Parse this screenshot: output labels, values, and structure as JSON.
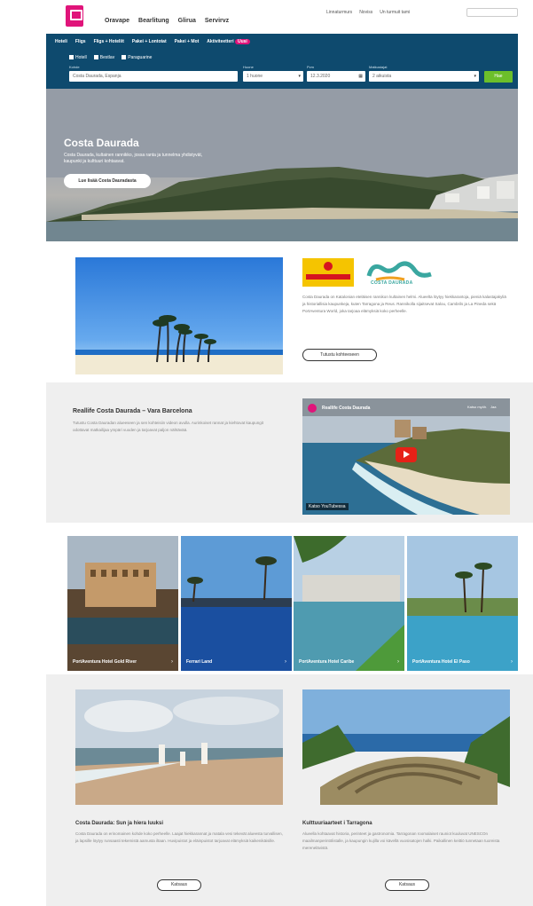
{
  "header": {
    "nav": [
      "Oravape",
      "Bearlitung",
      "Glirua",
      "Servirvz"
    ],
    "links": [
      "Linnaturmurs",
      "Noviss",
      "Un turmuit tami"
    ],
    "search_placeholder": ""
  },
  "booking": {
    "tabs": [
      "Hoteli",
      "Fligs",
      "Fligs + Hoteliit",
      "Pakei + Lontotat",
      "Pakei + Mot",
      "Aktiviteetteri"
    ],
    "new_badge": "Uusi",
    "options": [
      "Hotell",
      "Bestlav",
      "Paraguarine"
    ],
    "fields": {
      "destination": {
        "label": "Kohde",
        "value": "Costa Daurada, Espanja"
      },
      "rooms": {
        "label": "Huone",
        "value": "1 huone"
      },
      "date": {
        "label": "Pvm",
        "value": "12.3.2020"
      },
      "guests": {
        "label": "Matkustajat",
        "value": "2 aikuista"
      }
    },
    "search_button": "Hae"
  },
  "hero": {
    "title": "Costa Daurada",
    "subtitle": "Costa Daurada, kultainen rannikko, jossa ranta ja tunnelma yhdistyvät, kaupunki ja kulttuuri kohtaavat.",
    "button": "Lue lisää Costa Dauradasta",
    "colors": {
      "sky": "#9aa1aa",
      "sea": "#7d8c93"
    }
  },
  "intro": {
    "logo_left": "CATALUNYA",
    "logo_right": "COSTA DAURADA",
    "text": "Costa Daurada on Katalonian eteläisen rannikon kultainen helmi. Alueelta löytyy hiekkarantoja, pieniä kalastajakyliä ja historiallisia kaupunkeja, kuten Tarragona ja Reus. Rannikolla sijaitsevat Salou, Cambrils ja La Pineda sekä PortAventura World, joka tarjoaa elämyksiä koko perheelle.",
    "button": "Tutustu kohteeseen"
  },
  "video": {
    "title": "Reallife Costa Daurada – Vara Barcelona",
    "text": "Tutustu Costa Dauradan alueeseen ja sen kohteisiin videon avulla. Aurinkoiset rannat ja kiehtovat kaupungit odottavat matkailijaa ympäri vuoden ja tarjoavat paljon nähtävää.",
    "channel": "Reallife Costa Daurada",
    "watch_later": "Katso myöh.",
    "share": "Jaa",
    "watch_on": "Katso YouTubessa"
  },
  "cards": [
    {
      "label": "PortAventura Hotel Gold River"
    },
    {
      "label": "Ferrari Land"
    },
    {
      "label": "PortAventura Hotel Caribe"
    },
    {
      "label": "PortAventura Hotel El Paso"
    }
  ],
  "articles": [
    {
      "title": "Costa Daurada: Sun ja hiera luuksi",
      "text": "Costa Daurada on erinomainen kohde koko perheelle. Laajat hiekkarannat ja matala vesi tekevät alueesta turvallisen, ja lapsille löytyy runsaasti tekemistä aamusta iltaan. Huvipuistot ja eläinpuistot tarjoavat elämyksiä kaikenikäisille.",
      "button": "Katsaus"
    },
    {
      "title": "Kulttuuriaarteet i Tarragona",
      "text": "Alueella kohtaavat historia, perinteet ja gastronomia. Tarragonan roomalaiset rauniot kuuluvat UNESCOn maailmanperintölistalle, ja kaupungin kujilla voi kävellä vuosisatojen halki. Paikallinen keittiö tunnetaan tuoreista merenelävistä.",
      "button": "Katsaus"
    }
  ]
}
